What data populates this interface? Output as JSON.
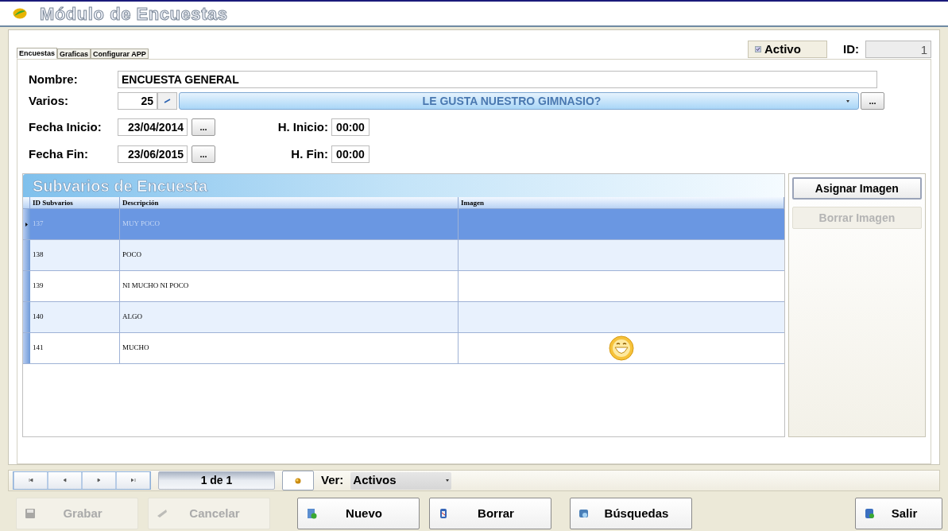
{
  "window": {
    "title": "Módulo de Encuestas"
  },
  "tabs": [
    {
      "label": "Encuestas",
      "selected": true
    },
    {
      "label": "Graficas",
      "selected": false
    },
    {
      "label": "Configurar APP",
      "selected": false
    }
  ],
  "activo": {
    "label": "Activo",
    "checked": true
  },
  "id": {
    "label": "ID:",
    "value": "1"
  },
  "form": {
    "nombre": {
      "label": "Nombre:",
      "value": "ENCUESTA GENERAL"
    },
    "varios": {
      "label": "Varios:",
      "code": "25",
      "value": "LE GUSTA NUESTRO GIMNASIO?",
      "more": "..."
    },
    "fecha_inicio": {
      "label": "Fecha Inicio:",
      "value": "23/04/2014",
      "more": "...",
      "time_label": "H. Inicio:",
      "time": "00:00"
    },
    "fecha_fin": {
      "label": "Fecha Fin:",
      "value": "23/06/2015",
      "more": "...",
      "time_label": "H. Fin:",
      "time": "00:00"
    }
  },
  "grid": {
    "title": "Subvarios de Encuesta",
    "columns": [
      "ID Subvarios",
      "Descripción",
      "Imagen"
    ],
    "rows": [
      {
        "id": "137",
        "description": "MUY POCO",
        "has_image": false,
        "selected": true
      },
      {
        "id": "138",
        "description": "POCO",
        "has_image": false,
        "selected": false
      },
      {
        "id": "139",
        "description": "NI MUCHO NI POCO",
        "has_image": false,
        "selected": false
      },
      {
        "id": "140",
        "description": "ALGO",
        "has_image": false,
        "selected": false
      },
      {
        "id": "141",
        "description": "MUCHO",
        "has_image": true,
        "selected": false
      }
    ]
  },
  "side_buttons": [
    {
      "label": "Asignar Imagen",
      "disabled": false
    },
    {
      "label": "Borrar Imagen",
      "disabled": true
    }
  ],
  "navigator": {
    "position": "1 de 1",
    "ver_label": "Ver:",
    "ver_value": "Activos"
  },
  "buttons": [
    {
      "kind": "save",
      "label": "Grabar",
      "disabled": true
    },
    {
      "kind": "cancel",
      "label": "Cancelar",
      "disabled": true
    },
    {
      "kind": "new",
      "label": "Nuevo",
      "disabled": false
    },
    {
      "kind": "delete",
      "label": "Borrar",
      "disabled": false
    },
    {
      "kind": "search",
      "label": "Búsquedas",
      "disabled": false
    },
    {
      "kind": "exit",
      "label": "Salir",
      "disabled": false
    }
  ]
}
